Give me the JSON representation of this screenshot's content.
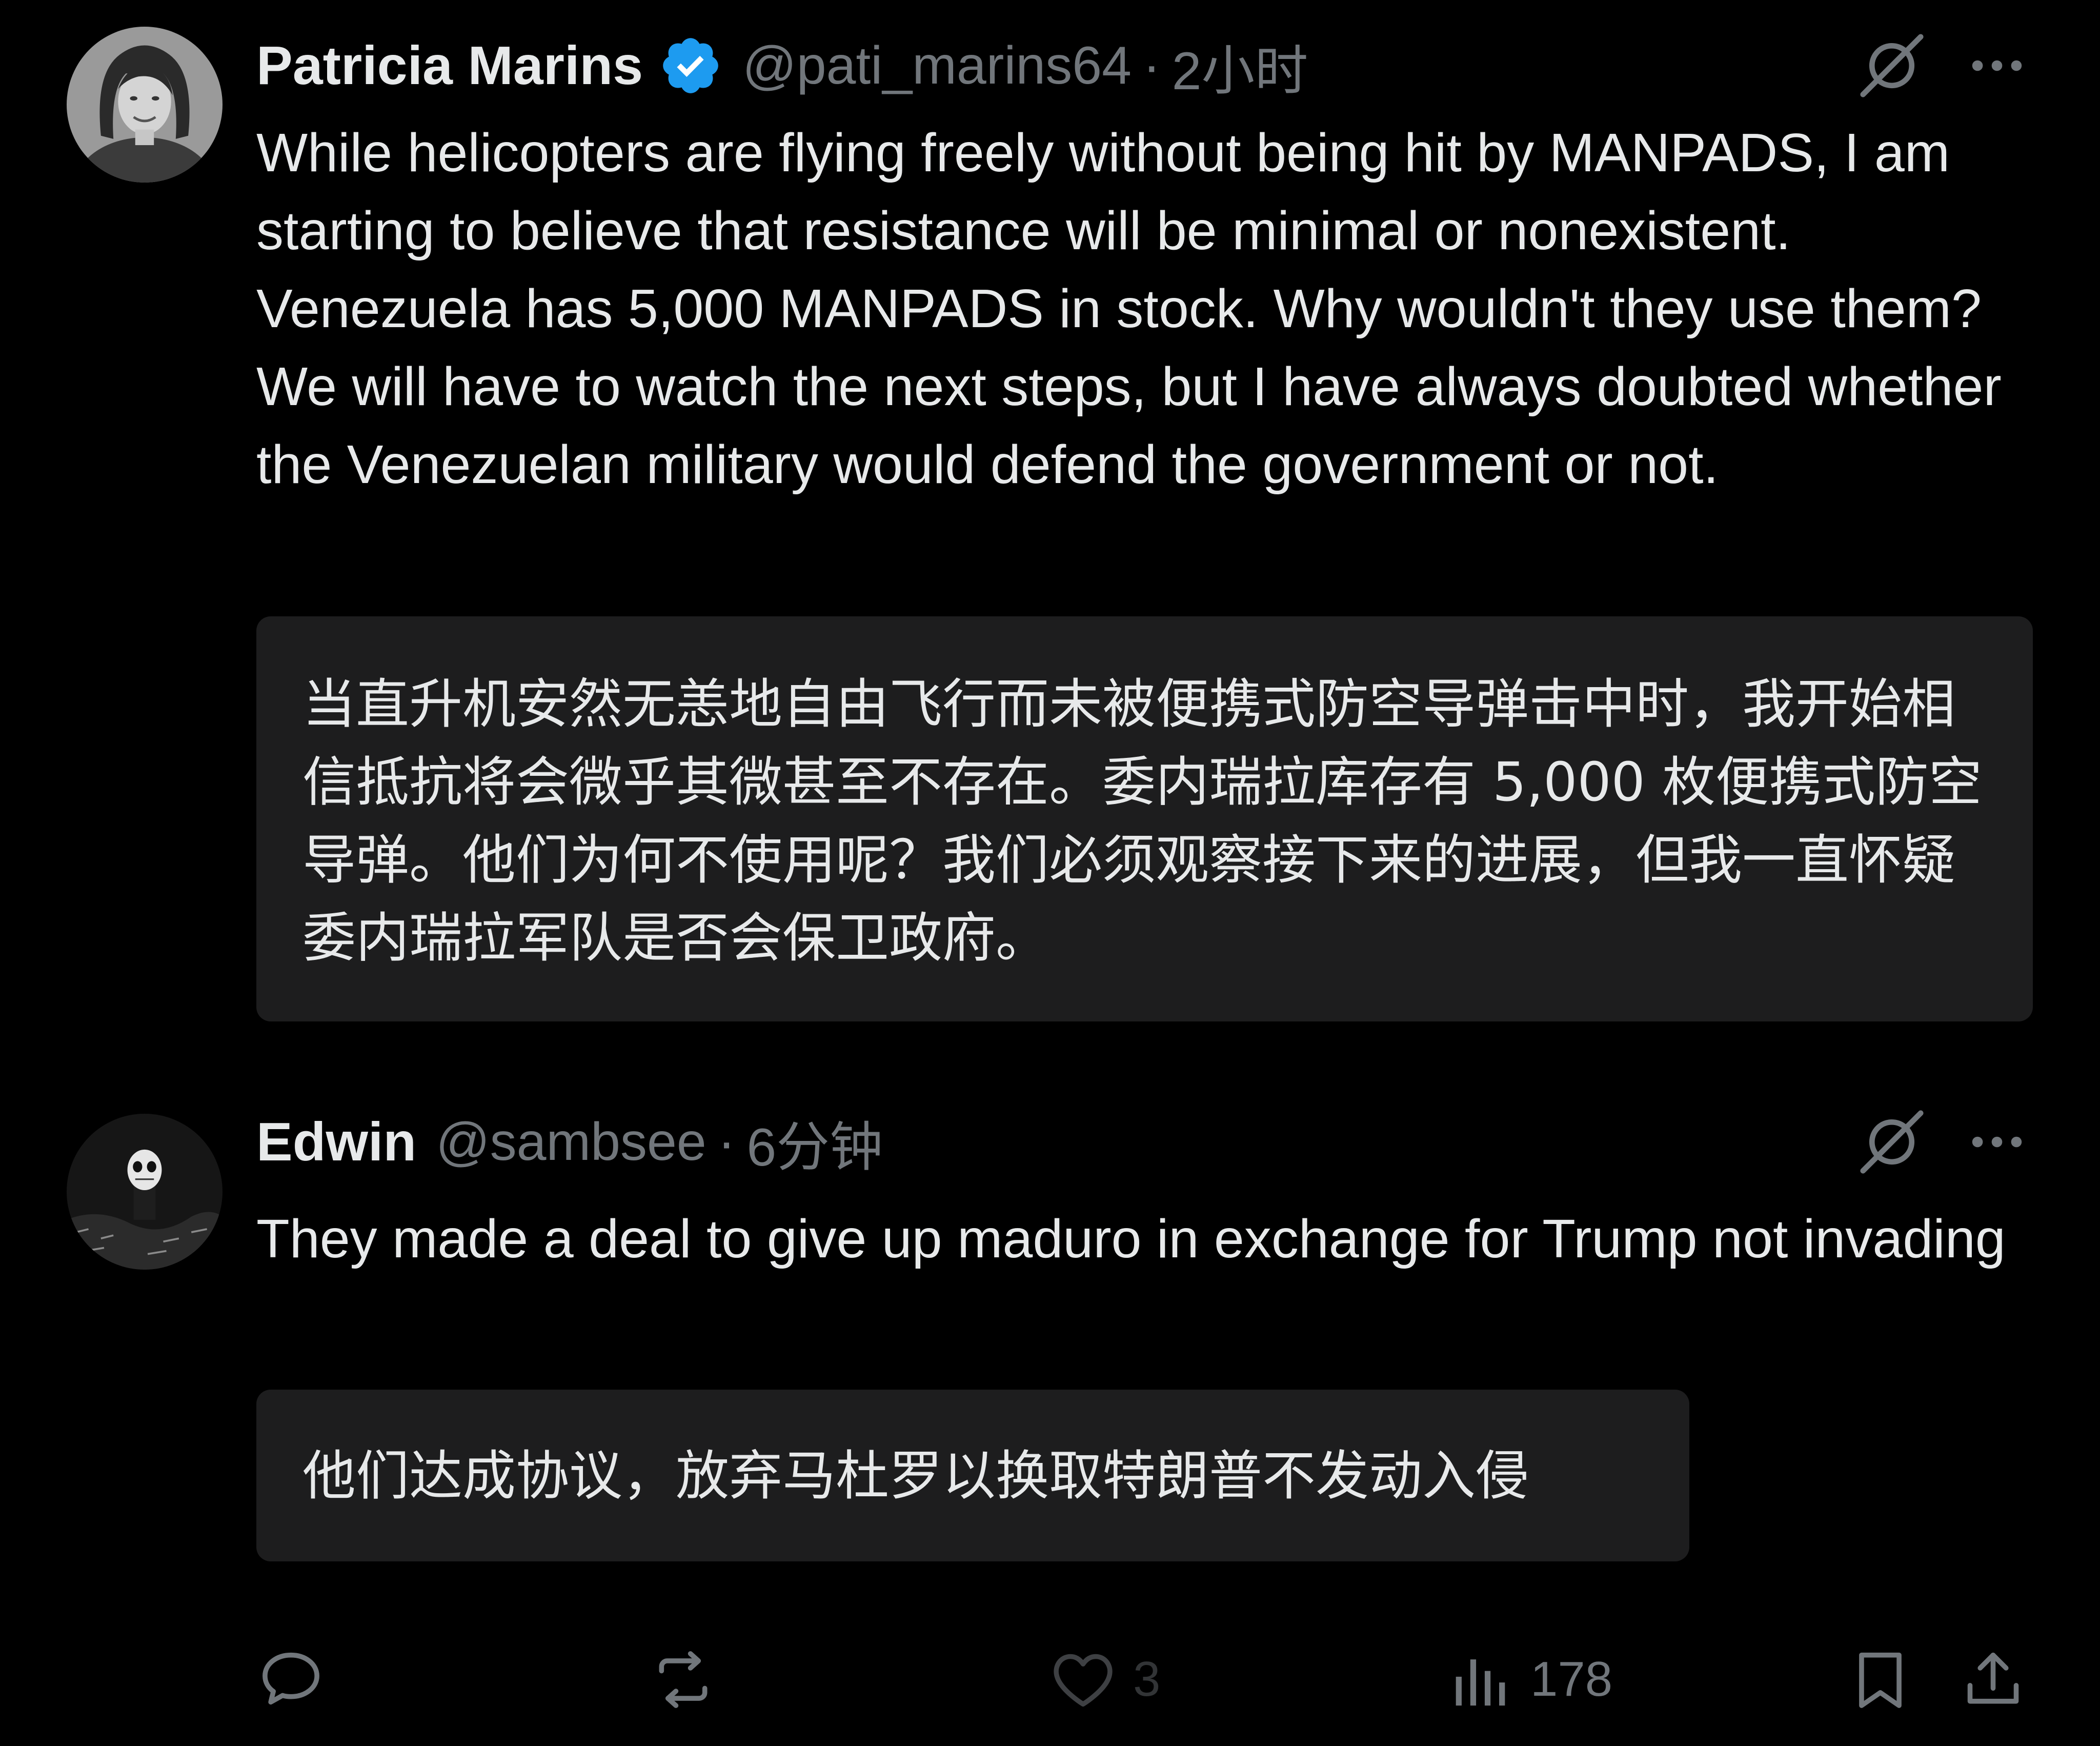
{
  "tweets": [
    {
      "author": {
        "display_name": "Patricia Marins",
        "handle": "@pati_marins64",
        "verified": true,
        "avatar": "woman-portrait-avatar"
      },
      "separator": "·",
      "timestamp": "2小时",
      "body": "While helicopters are flying freely without being hit by MANPADS, I am starting to believe that resistance will be minimal or nonexistent. Venezuela has 5,000 MANPADS in stock. Why wouldn't they use them? We will have to watch the next steps, but I have always doubted whether the Venezuelan military would defend the government or not.",
      "translation": "当直升机安然无恙地自由飞行而未被便携式防空导弹击中时，我开始相信抵抗将会微乎其微甚至不存在。委内瑞拉库存有 5,000 枚便携式防空导弹。他们为何不使用呢？我们必须观察接下来的进展，但我一直怀疑委内瑞拉军队是否会保卫政府。",
      "icons": [
        "grok-icon",
        "more-icon"
      ]
    },
    {
      "author": {
        "display_name": "Edwin",
        "handle": "@sambsee",
        "verified": false,
        "avatar": "figurine-avatar"
      },
      "separator": "·",
      "timestamp": "6分钟",
      "body": "They made a deal to give up maduro in exchange for Trump not invading",
      "translation": "他们达成协议，放弃马杜罗以换取特朗普不发动入侵",
      "icons": [
        "grok-icon",
        "more-icon"
      ]
    }
  ],
  "actions": {
    "reply": {
      "icon": "reply-icon"
    },
    "repost": {
      "icon": "repost-icon"
    },
    "like": {
      "icon": "like-icon",
      "count": "3"
    },
    "views": {
      "icon": "views-icon",
      "count": "178"
    },
    "bookmark": {
      "icon": "bookmark-icon"
    },
    "share": {
      "icon": "share-icon"
    }
  },
  "colors": {
    "background": "#000000",
    "text_primary": "#e7e9ea",
    "text_secondary": "#71767b",
    "verified_blue": "#1d9bf0",
    "translation_bg": "#1d1d1e"
  }
}
